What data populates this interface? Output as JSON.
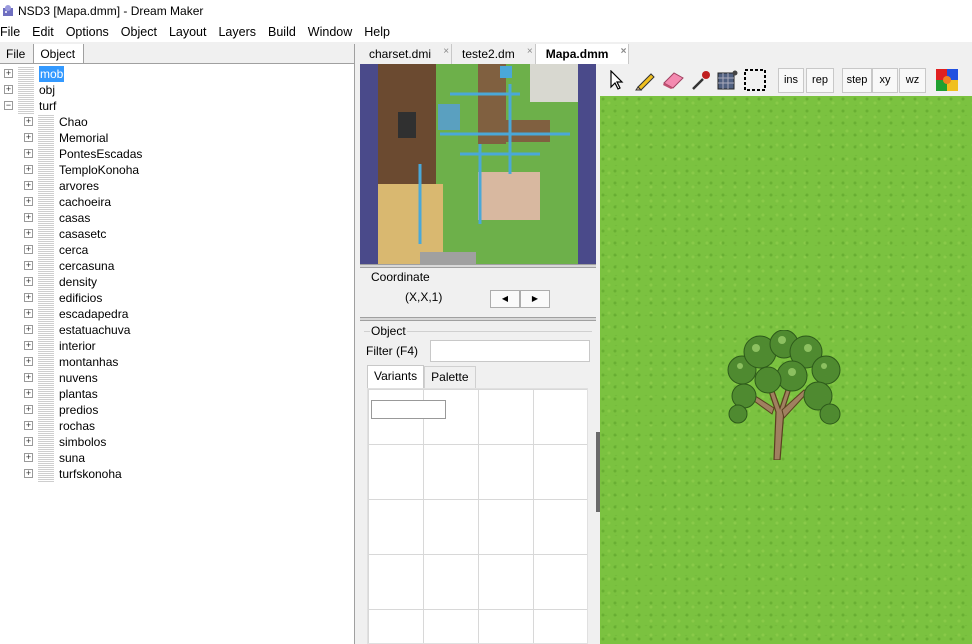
{
  "window": {
    "title": "NSD3 [Mapa.dmm] - Dream Maker"
  },
  "menu": [
    "File",
    "Edit",
    "Options",
    "Object",
    "Layout",
    "Layers",
    "Build",
    "Window",
    "Help"
  ],
  "left_panel": {
    "tabs": [
      "File",
      "Object"
    ],
    "tree": {
      "top": [
        {
          "label": "mob",
          "expander": "+"
        },
        {
          "label": "obj",
          "expander": "+"
        },
        {
          "label": "turf",
          "expander": "−"
        }
      ],
      "turf_children": [
        "Chao",
        "Memorial",
        "PontesEscadas",
        "TemploKonoha",
        "arvores",
        "cachoeira",
        "casas",
        "casasetc",
        "cerca",
        "cercasuna",
        "density",
        "edificios",
        "escadapedra",
        "estatuachuva",
        "interior",
        "montanhas",
        "nuvens",
        "plantas",
        "predios",
        "rochas",
        "simbolos",
        "suna",
        "turfskonoha"
      ]
    }
  },
  "doc_tabs": [
    {
      "label": "charset.dmi",
      "close": "×"
    },
    {
      "label": "teste2.dm",
      "close": "×"
    },
    {
      "label": "Mapa.dmm",
      "close": "×"
    }
  ],
  "coordinate_panel": {
    "label": "Coordinate",
    "value": "(X,X,1)",
    "prev": "◀",
    "next": "▶"
  },
  "object_panel": {
    "label": "Object",
    "filter_label": "Filter (F4)",
    "filter_value": "",
    "tabs": [
      "Variants",
      "Palette"
    ]
  },
  "toolbar": {
    "icons": [
      "cursor-icon",
      "pencil-icon",
      "eraser-icon",
      "eyedropper-icon",
      "grid-fill-icon",
      "select-rect-icon"
    ],
    "buttons": [
      "ins",
      "rep",
      "step",
      "xy",
      "wz"
    ],
    "extra_icon": "puzzle-icon"
  },
  "colors": {
    "selection": "#3399ff",
    "grass": "#7bc240",
    "minimap_border": "#4a4a8a"
  }
}
